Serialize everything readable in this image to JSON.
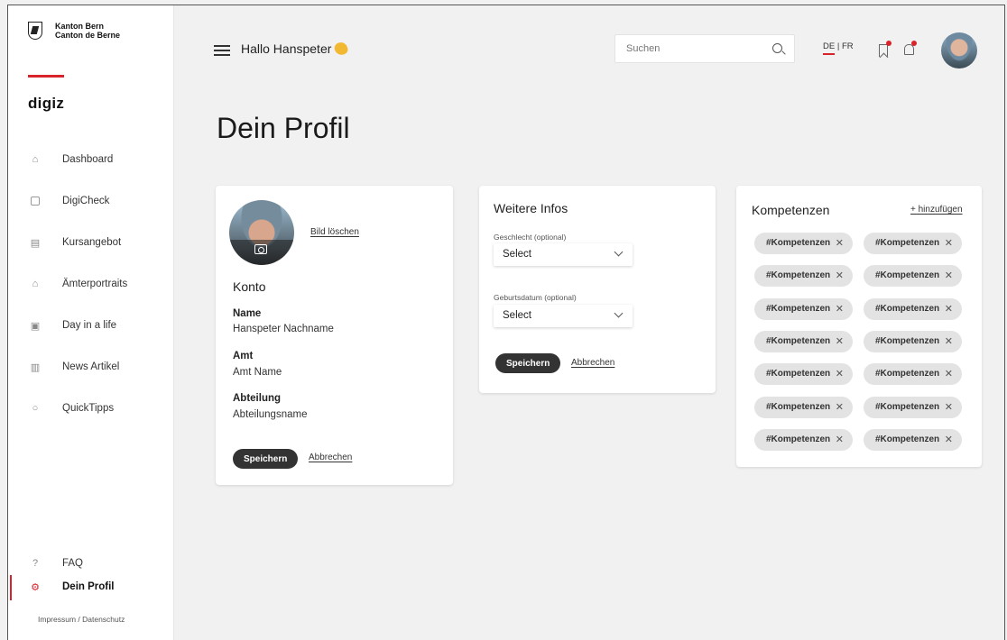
{
  "sidebar": {
    "logo_line1": "Kanton Bern",
    "logo_line2": "Canton de Berne",
    "brand": "digiz",
    "items": [
      {
        "label": "Dashboard",
        "icon": "home-icon"
      },
      {
        "label": "DigiCheck",
        "icon": "checkbox-icon"
      },
      {
        "label": "Kursangebot",
        "icon": "course-icon"
      },
      {
        "label": "Ämterportraits",
        "icon": "building-icon"
      },
      {
        "label": "Day in a life",
        "icon": "id-card-icon"
      },
      {
        "label": "News Artikel",
        "icon": "news-icon"
      },
      {
        "label": "QuickTipps",
        "icon": "lightbulb-icon"
      }
    ],
    "faq": "FAQ",
    "profile": "Dein Profil",
    "impressum": "Impressum / Datenschutz",
    "accent_color": "#d8232a"
  },
  "header": {
    "greeting": "Hallo Hanspeter",
    "search_placeholder": "Suchen",
    "lang_de": "DE",
    "lang_sep": "|",
    "lang_fr": "FR"
  },
  "page": {
    "title": "Dein Profil"
  },
  "account": {
    "delete_image": "Bild löschen",
    "heading": "Konto",
    "fields": [
      {
        "label": "Name",
        "value": "Hanspeter Nachname"
      },
      {
        "label": "Amt",
        "value": "Amt Name"
      },
      {
        "label": "Abteilung",
        "value": "Abteilungsname"
      }
    ],
    "save": "Speichern",
    "cancel": "Abbrechen"
  },
  "more_info": {
    "heading": "Weitere Infos",
    "gender_label": "Geschlecht (optional)",
    "gender_value": "Select",
    "birthdate_label": "Geburtsdatum (optional)",
    "birthdate_value": "Select",
    "save": "Speichern",
    "cancel": "Abbrechen"
  },
  "skills": {
    "heading": "Kompetenzen",
    "add": "+ hinzufügen",
    "chips": [
      "#Kompetenzen",
      "#Kompetenzen",
      "#Kompetenzen",
      "#Kompetenzen",
      "#Kompetenzen",
      "#Kompetenzen",
      "#Kompetenzen",
      "#Kompetenzen",
      "#Kompetenzen",
      "#Kompetenzen",
      "#Kompetenzen",
      "#Kompetenzen",
      "#Kompetenzen",
      "#Kompetenzen"
    ],
    "remove_glyph": "✕"
  }
}
